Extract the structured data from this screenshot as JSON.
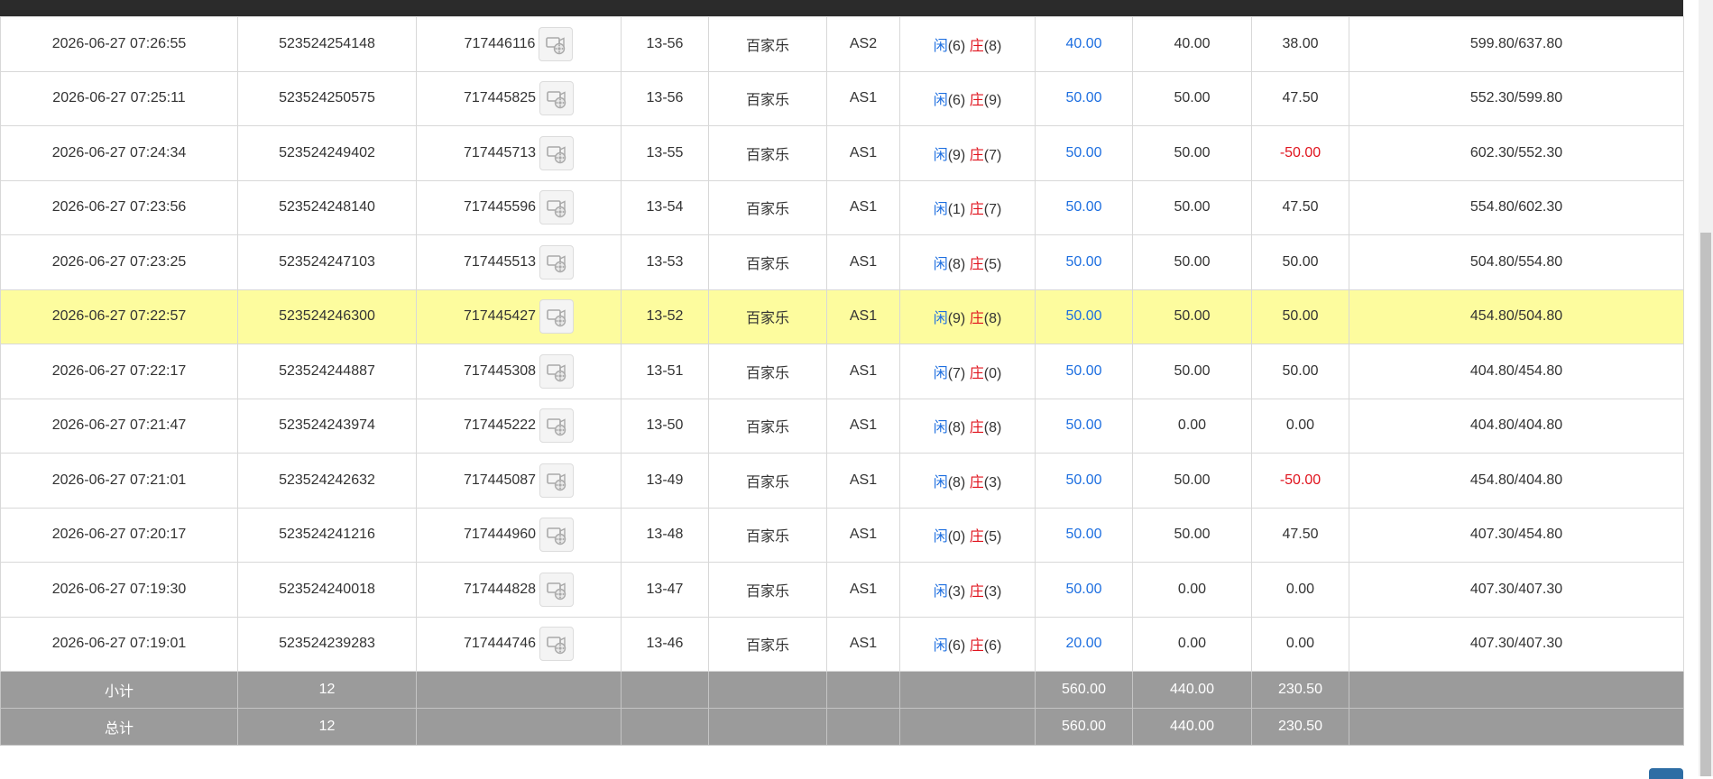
{
  "colors": {
    "blue": "#1e6fe0",
    "red": "#e0141e",
    "highlight": "#fdfc9e",
    "total_bg": "#9b9b9b"
  },
  "rows": [
    {
      "time": "2026-06-27 07:26:55",
      "bet_id": "523524254148",
      "round_id": "717446116",
      "shoe": "13-56",
      "game": "百家乐",
      "table": "AS2",
      "player_label": "闲",
      "player_score": "(6)",
      "banker_label": "庄",
      "banker_score": "(8)",
      "bet_amount": "40.00",
      "valid_bet": "40.00",
      "win_loss": "38.00",
      "win_negative": false,
      "balance": "599.80/637.80",
      "highlight": false
    },
    {
      "time": "2026-06-27 07:25:11",
      "bet_id": "523524250575",
      "round_id": "717445825",
      "shoe": "13-56",
      "game": "百家乐",
      "table": "AS1",
      "player_label": "闲",
      "player_score": "(6)",
      "banker_label": "庄",
      "banker_score": "(9)",
      "bet_amount": "50.00",
      "valid_bet": "50.00",
      "win_loss": "47.50",
      "win_negative": false,
      "balance": "552.30/599.80",
      "highlight": false
    },
    {
      "time": "2026-06-27 07:24:34",
      "bet_id": "523524249402",
      "round_id": "717445713",
      "shoe": "13-55",
      "game": "百家乐",
      "table": "AS1",
      "player_label": "闲",
      "player_score": "(9)",
      "banker_label": "庄",
      "banker_score": "(7)",
      "bet_amount": "50.00",
      "valid_bet": "50.00",
      "win_loss": "-50.00",
      "win_negative": true,
      "balance": "602.30/552.30",
      "highlight": false
    },
    {
      "time": "2026-06-27 07:23:56",
      "bet_id": "523524248140",
      "round_id": "717445596",
      "shoe": "13-54",
      "game": "百家乐",
      "table": "AS1",
      "player_label": "闲",
      "player_score": "(1)",
      "banker_label": "庄",
      "banker_score": "(7)",
      "bet_amount": "50.00",
      "valid_bet": "50.00",
      "win_loss": "47.50",
      "win_negative": false,
      "balance": "554.80/602.30",
      "highlight": false
    },
    {
      "time": "2026-06-27 07:23:25",
      "bet_id": "523524247103",
      "round_id": "717445513",
      "shoe": "13-53",
      "game": "百家乐",
      "table": "AS1",
      "player_label": "闲",
      "player_score": "(8)",
      "banker_label": "庄",
      "banker_score": "(5)",
      "bet_amount": "50.00",
      "valid_bet": "50.00",
      "win_loss": "50.00",
      "win_negative": false,
      "balance": "504.80/554.80",
      "highlight": false
    },
    {
      "time": "2026-06-27 07:22:57",
      "bet_id": "523524246300",
      "round_id": "717445427",
      "shoe": "13-52",
      "game": "百家乐",
      "table": "AS1",
      "player_label": "闲",
      "player_score": "(9)",
      "banker_label": "庄",
      "banker_score": "(8)",
      "bet_amount": "50.00",
      "valid_bet": "50.00",
      "win_loss": "50.00",
      "win_negative": false,
      "balance": "454.80/504.80",
      "highlight": true
    },
    {
      "time": "2026-06-27 07:22:17",
      "bet_id": "523524244887",
      "round_id": "717445308",
      "shoe": "13-51",
      "game": "百家乐",
      "table": "AS1",
      "player_label": "闲",
      "player_score": "(7)",
      "banker_label": "庄",
      "banker_score": "(0)",
      "bet_amount": "50.00",
      "valid_bet": "50.00",
      "win_loss": "50.00",
      "win_negative": false,
      "balance": "404.80/454.80",
      "highlight": false
    },
    {
      "time": "2026-06-27 07:21:47",
      "bet_id": "523524243974",
      "round_id": "717445222",
      "shoe": "13-50",
      "game": "百家乐",
      "table": "AS1",
      "player_label": "闲",
      "player_score": "(8)",
      "banker_label": "庄",
      "banker_score": "(8)",
      "bet_amount": "50.00",
      "valid_bet": "0.00",
      "win_loss": "0.00",
      "win_negative": false,
      "balance": "404.80/404.80",
      "highlight": false
    },
    {
      "time": "2026-06-27 07:21:01",
      "bet_id": "523524242632",
      "round_id": "717445087",
      "shoe": "13-49",
      "game": "百家乐",
      "table": "AS1",
      "player_label": "闲",
      "player_score": "(8)",
      "banker_label": "庄",
      "banker_score": "(3)",
      "bet_amount": "50.00",
      "valid_bet": "50.00",
      "win_loss": "-50.00",
      "win_negative": true,
      "balance": "454.80/404.80",
      "highlight": false
    },
    {
      "time": "2026-06-27 07:20:17",
      "bet_id": "523524241216",
      "round_id": "717444960",
      "shoe": "13-48",
      "game": "百家乐",
      "table": "AS1",
      "player_label": "闲",
      "player_score": "(0)",
      "banker_label": "庄",
      "banker_score": "(5)",
      "bet_amount": "50.00",
      "valid_bet": "50.00",
      "win_loss": "47.50",
      "win_negative": false,
      "balance": "407.30/454.80",
      "highlight": false
    },
    {
      "time": "2026-06-27 07:19:30",
      "bet_id": "523524240018",
      "round_id": "717444828",
      "shoe": "13-47",
      "game": "百家乐",
      "table": "AS1",
      "player_label": "闲",
      "player_score": "(3)",
      "banker_label": "庄",
      "banker_score": "(3)",
      "bet_amount": "50.00",
      "valid_bet": "0.00",
      "win_loss": "0.00",
      "win_negative": false,
      "balance": "407.30/407.30",
      "highlight": false
    },
    {
      "time": "2026-06-27 07:19:01",
      "bet_id": "523524239283",
      "round_id": "717444746",
      "shoe": "13-46",
      "game": "百家乐",
      "table": "AS1",
      "player_label": "闲",
      "player_score": "(6)",
      "banker_label": "庄",
      "banker_score": "(6)",
      "bet_amount": "20.00",
      "valid_bet": "0.00",
      "win_loss": "0.00",
      "win_negative": false,
      "balance": "407.30/407.30",
      "highlight": false
    }
  ],
  "subtotal": {
    "label": "小计",
    "count": "12",
    "bet_amount": "560.00",
    "valid_bet": "440.00",
    "win_loss": "230.50"
  },
  "total": {
    "label": "总计",
    "count": "12",
    "bet_amount": "560.00",
    "valid_bet": "440.00",
    "win_loss": "230.50"
  }
}
